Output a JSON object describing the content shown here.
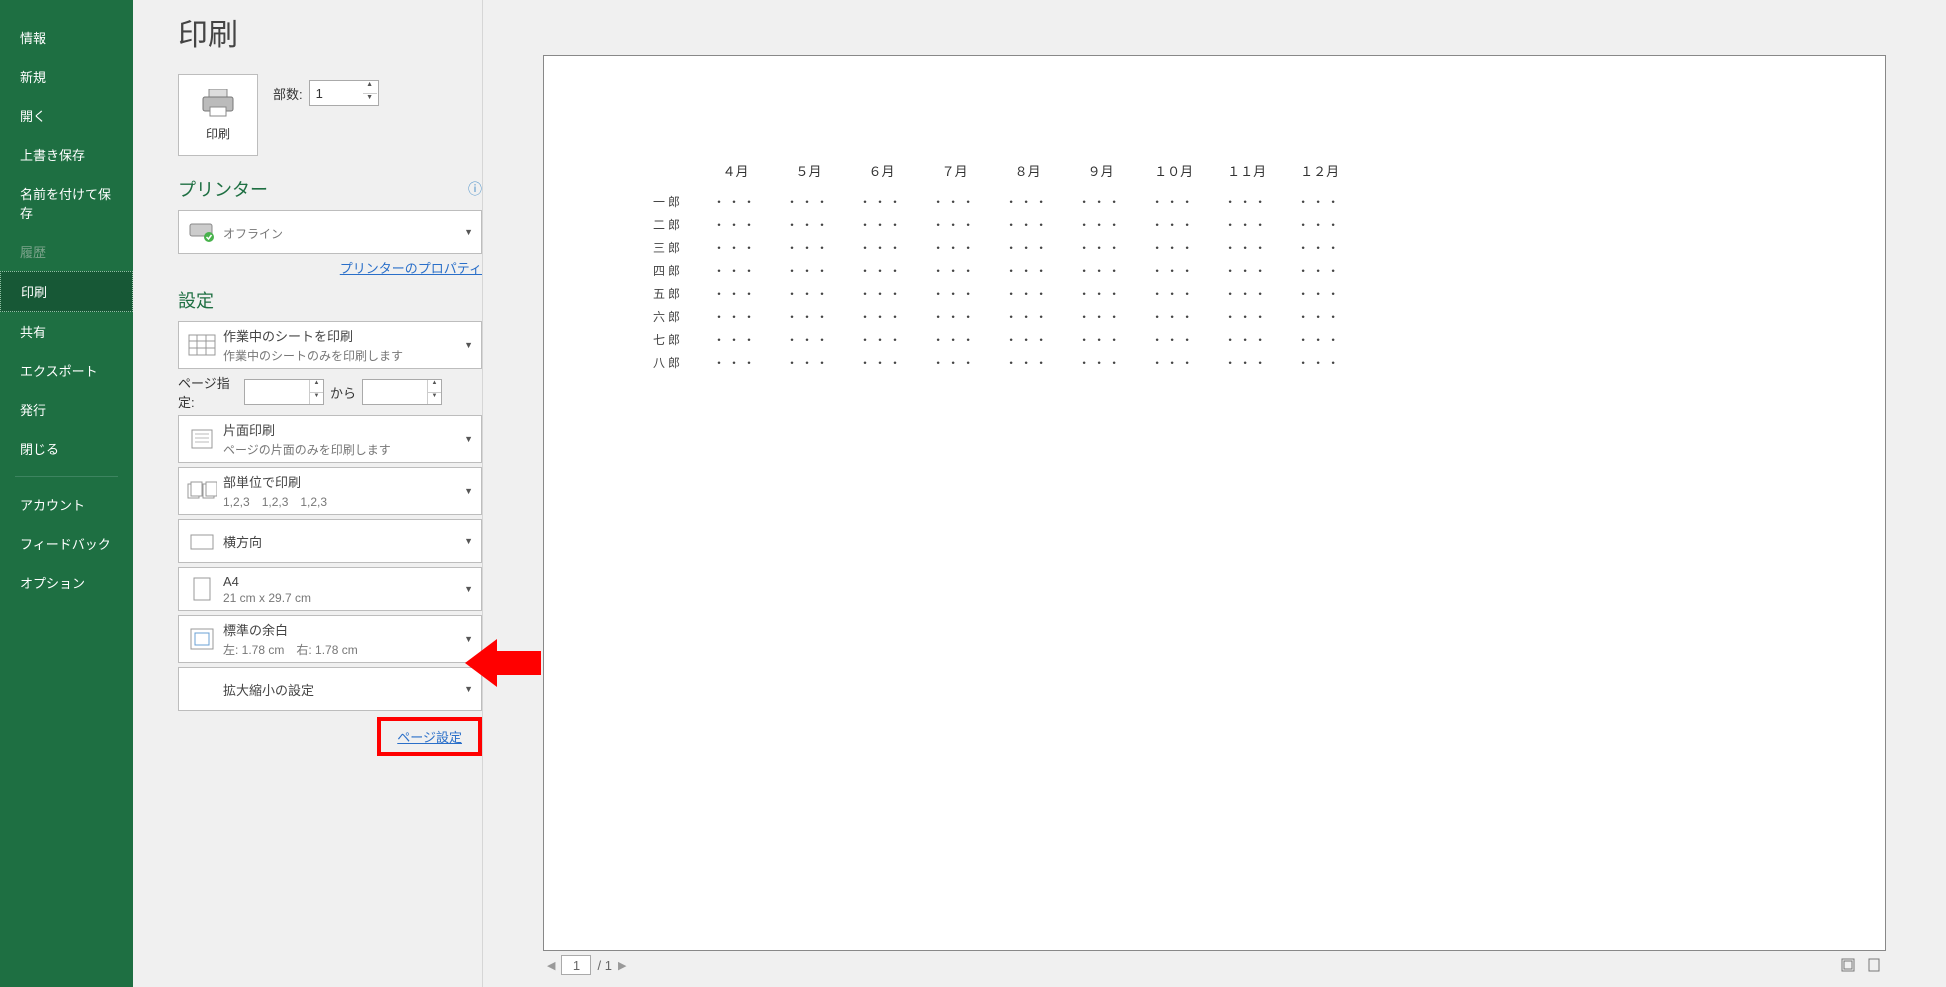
{
  "sidebar": {
    "items": [
      {
        "label": "情報"
      },
      {
        "label": "新規"
      },
      {
        "label": "開く"
      },
      {
        "label": "上書き保存"
      },
      {
        "label": "名前を付けて保存"
      },
      {
        "label": "履歴"
      },
      {
        "label": "印刷"
      },
      {
        "label": "共有"
      },
      {
        "label": "エクスポート"
      },
      {
        "label": "発行"
      },
      {
        "label": "閉じる"
      }
    ],
    "account": "アカウント",
    "feedback": "フィードバック",
    "options": "オプション"
  },
  "title": "印刷",
  "print_tile_label": "印刷",
  "copies_label": "部数:",
  "copies_value": "1",
  "printer_section": "プリンター",
  "printer_status": "オフライン",
  "printer_properties_link": "プリンターのプロパティ",
  "settings_section": "設定",
  "dd_sheet_title": "作業中のシートを印刷",
  "dd_sheet_sub": "作業中のシートのみを印刷します",
  "page_range_label": "ページ指定:",
  "page_range_to": "から",
  "dd_side_title": "片面印刷",
  "dd_side_sub": "ページの片面のみを印刷します",
  "dd_collate_title": "部単位で印刷",
  "dd_collate_sub": "1,2,3　1,2,3　1,2,3",
  "dd_orient": "横方向",
  "dd_paper_title": "A4",
  "dd_paper_sub": "21 cm x 29.7 cm",
  "dd_margin_title": "標準の余白",
  "dd_margin_sub": "左: 1.78 cm　右: 1.78 cm",
  "dd_scale": "拡大縮小の設定",
  "page_setup_link": "ページ設定",
  "preview": {
    "months": [
      "４月",
      "５月",
      "６月",
      "７月",
      "８月",
      "９月",
      "１０月",
      "１１月",
      "１２月"
    ],
    "rows": [
      "一郎",
      "二郎",
      "三郎",
      "四郎",
      "五郎",
      "六郎",
      "七郎",
      "八郎"
    ],
    "cell": "・・・"
  },
  "pager": {
    "current": "1",
    "total": "1"
  }
}
